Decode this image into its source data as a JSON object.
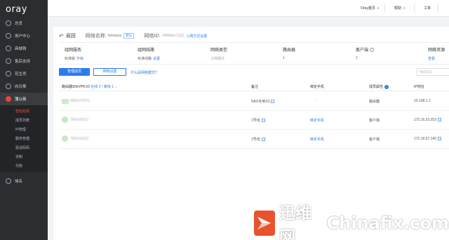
{
  "app": {
    "logo": "oray"
  },
  "sidebar": {
    "items": [
      {
        "label": "总览",
        "icon": "home-icon"
      },
      {
        "label": "用户中心",
        "icon": "user-icon"
      },
      {
        "label": "商城购",
        "icon": "cart-icon"
      },
      {
        "label": "售后支持",
        "icon": "support-icon"
      },
      {
        "label": "花生壳",
        "icon": "peanut-icon"
      },
      {
        "label": "向日葵",
        "icon": "sunflower-icon"
      },
      {
        "label": "蒲公英",
        "icon": "dandelion-icon"
      }
    ],
    "subitems": [
      {
        "label": "智能组网"
      },
      {
        "label": "成员列表"
      },
      {
        "label": "IP管理"
      },
      {
        "label": "服务管理"
      },
      {
        "label": "验证码码"
      },
      {
        "label": "定制"
      },
      {
        "label": "代购"
      }
    ],
    "bottom_item": {
      "label": "域名",
      "icon": "globe-icon"
    }
  },
  "topbar": {
    "home": "Oray首页",
    "help": "帮助",
    "ticket": "工单"
  },
  "header": {
    "back": "返回",
    "network_name_label": "网络名称:",
    "network_name_value": "hekejcps",
    "network_name_tag": "默认",
    "network_id_label": "网络ID:",
    "network_id_value": "784xxx7112",
    "join_link": "入网方式设置"
  },
  "info": {
    "service": {
      "title": "组网服务",
      "value": "标准版",
      "link": "升级"
    },
    "line": {
      "title": "组网线路",
      "value": "标准线路",
      "link": "设置"
    },
    "type": {
      "title": "网络类型",
      "value": "分网模式"
    },
    "router": {
      "title": "路由器",
      "value": "1"
    },
    "client": {
      "title": "客户端",
      "value": "2"
    },
    "resource": {
      "title": "网络资源",
      "link": "查看"
    }
  },
  "actions": {
    "manage_btn": "管理成员",
    "settings_btn": "网络设置",
    "mode_link": "什么是网络模式?",
    "search_placeholder": "搜索成员"
  },
  "table": {
    "col_device": "路由器SN/VPN ID",
    "col_device_extra": "在线 2 / 离线 1",
    "col_note": "备注",
    "col_phone": "绑定手机",
    "col_member": "成员属性",
    "col_ip": "IP地址",
    "rows": [
      {
        "name": "AB8XX7FF3",
        "note": "NAS专用X3",
        "phone": "-",
        "member": "路由器",
        "ip": "10.168.1.1"
      },
      {
        "name": "784XX6512",
        "note": "1号线",
        "phone": "绑定手机",
        "member": "客户端",
        "ip": "172.16.23.253"
      },
      {
        "name": "784XX6622",
        "note": "2号线",
        "phone": "绑定手机",
        "member": "客户端",
        "ip": "172.16.67.146"
      }
    ]
  },
  "watermark": {
    "cn": "迅维网",
    "en": "Chinafix.com"
  }
}
